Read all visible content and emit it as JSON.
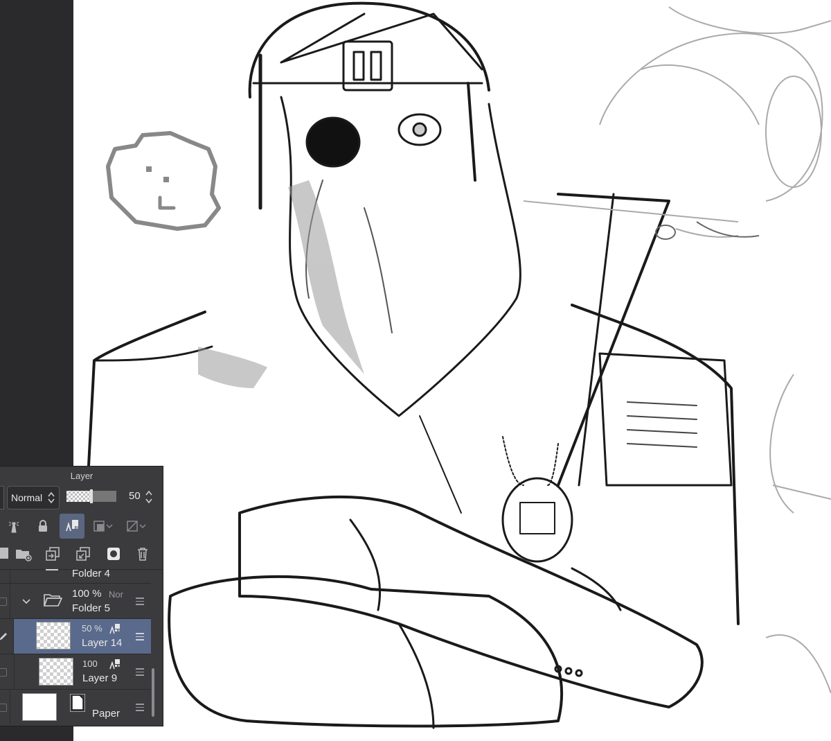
{
  "panel": {
    "title": "Layer",
    "blend_mode": "Normal",
    "opacity_value": "50"
  },
  "toolbar": {
    "row1": [
      "lighthouse-icon",
      "lock-icon",
      "clip-icon",
      "mask-icon",
      "mask-off-icon"
    ],
    "row2": [
      "new-layer-icon",
      "new-folder-icon",
      "copy-layer-icon",
      "transfer-icon",
      "layer-mask-icon",
      "trash-icon"
    ]
  },
  "layers": [
    {
      "name": "Folder 4",
      "opacity": "",
      "blend": ""
    },
    {
      "name": "Folder 5",
      "opacity": "100 %",
      "blend": "Nor"
    },
    {
      "name": "Layer 14",
      "opacity": "50 %",
      "blend": ""
    },
    {
      "name": "Layer 9",
      "opacity": "100",
      "blend": ""
    },
    {
      "name": "Paper",
      "opacity": "",
      "blend": ""
    }
  ]
}
